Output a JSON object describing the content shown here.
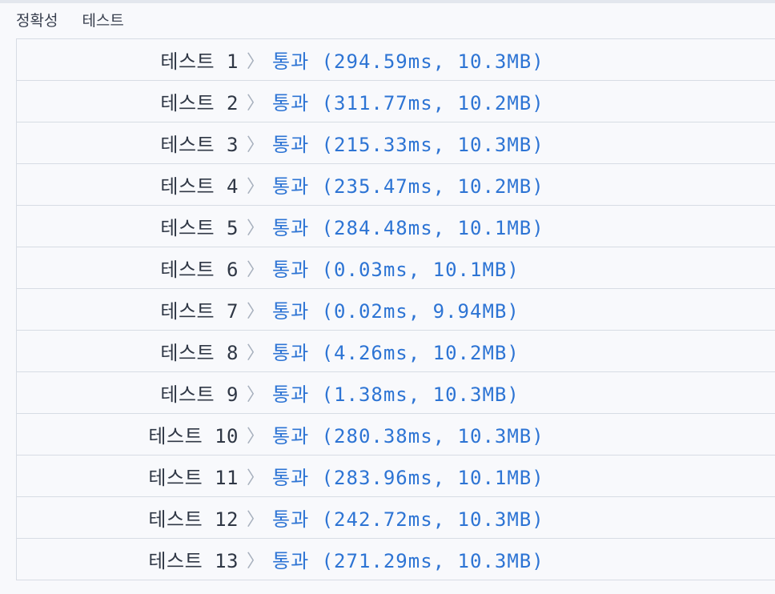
{
  "tabs": [
    "정확성",
    "테스트"
  ],
  "chevron": "〉",
  "results": [
    {
      "label": "테스트 1",
      "result": "통과 (294.59ms, 10.3MB)"
    },
    {
      "label": "테스트 2",
      "result": "통과 (311.77ms, 10.2MB)"
    },
    {
      "label": "테스트 3",
      "result": "통과 (215.33ms, 10.3MB)"
    },
    {
      "label": "테스트 4",
      "result": "통과 (235.47ms, 10.2MB)"
    },
    {
      "label": "테스트 5",
      "result": "통과 (284.48ms, 10.1MB)"
    },
    {
      "label": "테스트 6",
      "result": "통과 (0.03ms, 10.1MB)"
    },
    {
      "label": "테스트 7",
      "result": "통과 (0.02ms, 9.94MB)"
    },
    {
      "label": "테스트 8",
      "result": "통과 (4.26ms, 10.2MB)"
    },
    {
      "label": "테스트 9",
      "result": "통과 (1.38ms, 10.3MB)"
    },
    {
      "label": "테스트 10",
      "result": "통과 (280.38ms, 10.3MB)"
    },
    {
      "label": "테스트 11",
      "result": "통과 (283.96ms, 10.1MB)"
    },
    {
      "label": "테스트 12",
      "result": "통과 (242.72ms, 10.3MB)"
    },
    {
      "label": "테스트 13",
      "result": "통과 (271.29ms, 10.3MB)"
    }
  ]
}
